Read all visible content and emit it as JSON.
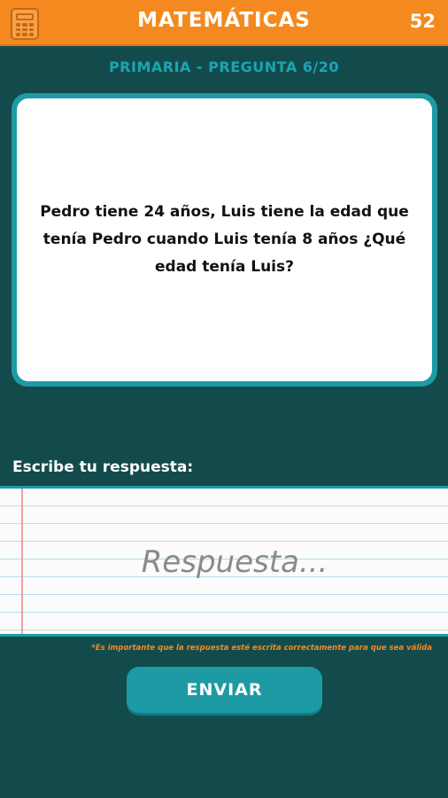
{
  "header": {
    "title": "MATEMÁTICAS",
    "score": "52",
    "icon": "calculator-icon",
    "background_color": "#f48a1f"
  },
  "level": {
    "subtitle": "PRIMARIA - PREGUNTA 6/20"
  },
  "question": {
    "text": "Pedro tiene 24 años, Luis tiene la edad que tenía Pedro cuando Luis tenía 8 años ¿Qué edad tenía Luis?"
  },
  "answer": {
    "label": "Escribe tu respuesta:",
    "placeholder": "Respuesta...",
    "value": "",
    "note": "*Es importante que la respuesta esté escrita correctamente para que sea válida"
  },
  "actions": {
    "send_label": "ENVIAR"
  },
  "colors": {
    "background": "#134b4c",
    "accent_teal": "#1e9aa5",
    "accent_orange": "#f48a1f"
  }
}
